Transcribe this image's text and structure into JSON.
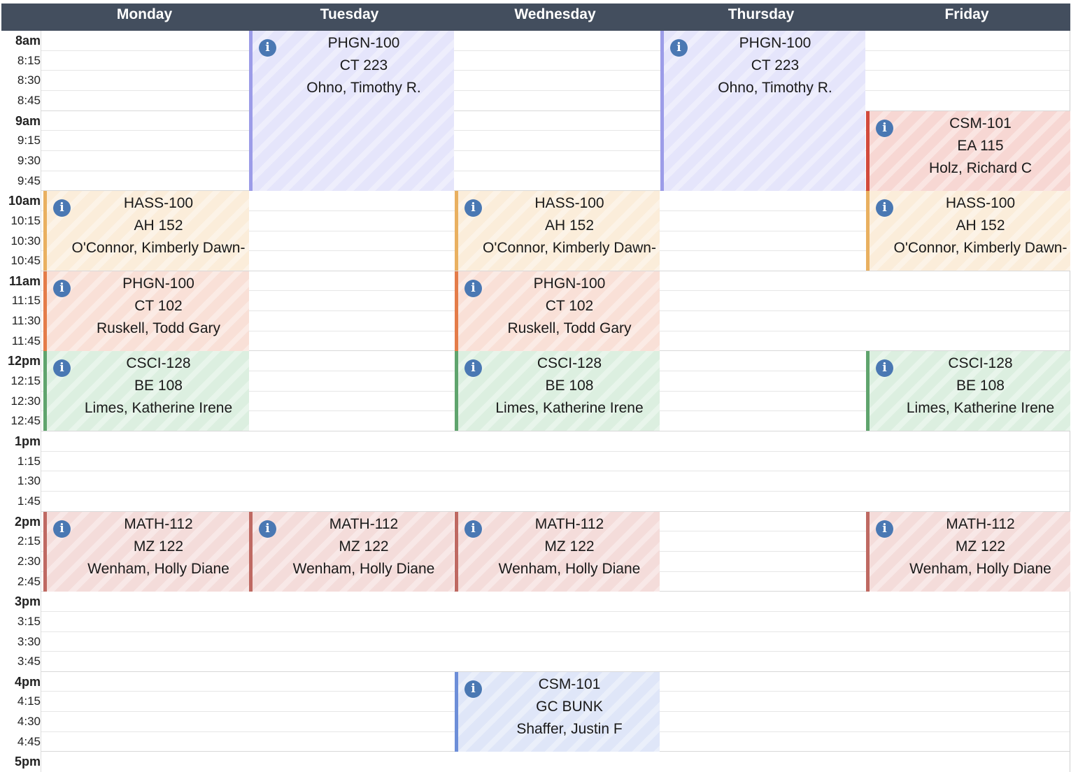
{
  "days": [
    "Monday",
    "Tuesday",
    "Wednesday",
    "Thursday",
    "Friday"
  ],
  "times": [
    "8am",
    "8:15",
    "8:30",
    "8:45",
    "9am",
    "9:15",
    "9:30",
    "9:45",
    "10am",
    "10:15",
    "10:30",
    "10:45",
    "11am",
    "11:15",
    "11:30",
    "11:45",
    "12pm",
    "12:15",
    "12:30",
    "12:45",
    "1pm",
    "1:15",
    "1:30",
    "1:45",
    "2pm",
    "2:15",
    "2:30",
    "2:45",
    "3pm",
    "3:15",
    "3:30",
    "3:45",
    "4pm",
    "4:15",
    "4:30",
    "4:45",
    "5pm"
  ],
  "colors": {
    "header_bg": "#434e5e",
    "info_icon": "#4a78b3",
    "PHGN-100_lecture": {
      "bg": "#e5e5fb",
      "border": "#9c9ce8"
    },
    "CSM-101_holz": {
      "bg": "#f7d7d3",
      "border": "#d24a3c"
    },
    "HASS-100": {
      "bg": "#fbedda",
      "border": "#e9b060"
    },
    "PHGN-100_lab": {
      "bg": "#f9e0d7",
      "border": "#e47c49"
    },
    "CSCI-128": {
      "bg": "#dcefe0",
      "border": "#5fa46d"
    },
    "MATH-112": {
      "bg": "#f4dcda",
      "border": "#bf6962"
    },
    "CSM-101_shaffer": {
      "bg": "#dfe6f8",
      "border": "#6d8ed8"
    }
  },
  "events": [
    {
      "day": 1,
      "start": "8am",
      "end": "9:45",
      "course": "PHGN-100",
      "room": "CT 223",
      "instructor": "Ohno, Timothy R.",
      "color_key": "PHGN-100_lecture"
    },
    {
      "day": 3,
      "start": "8am",
      "end": "9:45",
      "course": "PHGN-100",
      "room": "CT 223",
      "instructor": "Ohno, Timothy R.",
      "color_key": "PHGN-100_lecture"
    },
    {
      "day": 4,
      "start": "9am",
      "end": "9:45",
      "course": "CSM-101",
      "room": "EA 115",
      "instructor": "Holz, Richard C",
      "color_key": "CSM-101_holz"
    },
    {
      "day": 0,
      "start": "10am",
      "end": "10:45",
      "course": "HASS-100",
      "room": "AH 152",
      "instructor": "O'Connor, Kimberly Dawn-",
      "color_key": "HASS-100"
    },
    {
      "day": 2,
      "start": "10am",
      "end": "10:45",
      "course": "HASS-100",
      "room": "AH 152",
      "instructor": "O'Connor, Kimberly Dawn-",
      "color_key": "HASS-100"
    },
    {
      "day": 4,
      "start": "10am",
      "end": "10:45",
      "course": "HASS-100",
      "room": "AH 152",
      "instructor": "O'Connor, Kimberly Dawn-",
      "color_key": "HASS-100"
    },
    {
      "day": 0,
      "start": "11am",
      "end": "11:45",
      "course": "PHGN-100",
      "room": "CT 102",
      "instructor": "Ruskell, Todd Gary",
      "color_key": "PHGN-100_lab"
    },
    {
      "day": 2,
      "start": "11am",
      "end": "11:45",
      "course": "PHGN-100",
      "room": "CT 102",
      "instructor": "Ruskell, Todd Gary",
      "color_key": "PHGN-100_lab"
    },
    {
      "day": 0,
      "start": "12pm",
      "end": "12:45",
      "course": "CSCI-128",
      "room": "BE 108",
      "instructor": "Limes, Katherine Irene",
      "color_key": "CSCI-128"
    },
    {
      "day": 2,
      "start": "12pm",
      "end": "12:45",
      "course": "CSCI-128",
      "room": "BE 108",
      "instructor": "Limes, Katherine Irene",
      "color_key": "CSCI-128"
    },
    {
      "day": 4,
      "start": "12pm",
      "end": "12:45",
      "course": "CSCI-128",
      "room": "BE 108",
      "instructor": "Limes, Katherine Irene",
      "color_key": "CSCI-128"
    },
    {
      "day": 0,
      "start": "2pm",
      "end": "2:45",
      "course": "MATH-112",
      "room": "MZ 122",
      "instructor": "Wenham, Holly Diane",
      "color_key": "MATH-112"
    },
    {
      "day": 1,
      "start": "2pm",
      "end": "2:45",
      "course": "MATH-112",
      "room": "MZ 122",
      "instructor": "Wenham, Holly Diane",
      "color_key": "MATH-112"
    },
    {
      "day": 2,
      "start": "2pm",
      "end": "2:45",
      "course": "MATH-112",
      "room": "MZ 122",
      "instructor": "Wenham, Holly Diane",
      "color_key": "MATH-112"
    },
    {
      "day": 4,
      "start": "2pm",
      "end": "2:45",
      "course": "MATH-112",
      "room": "MZ 122",
      "instructor": "Wenham, Holly Diane",
      "color_key": "MATH-112"
    },
    {
      "day": 2,
      "start": "4pm",
      "end": "4:45",
      "course": "CSM-101",
      "room": "GC BUNK",
      "instructor": "Shaffer, Justin F",
      "color_key": "CSM-101_shaffer"
    }
  ]
}
